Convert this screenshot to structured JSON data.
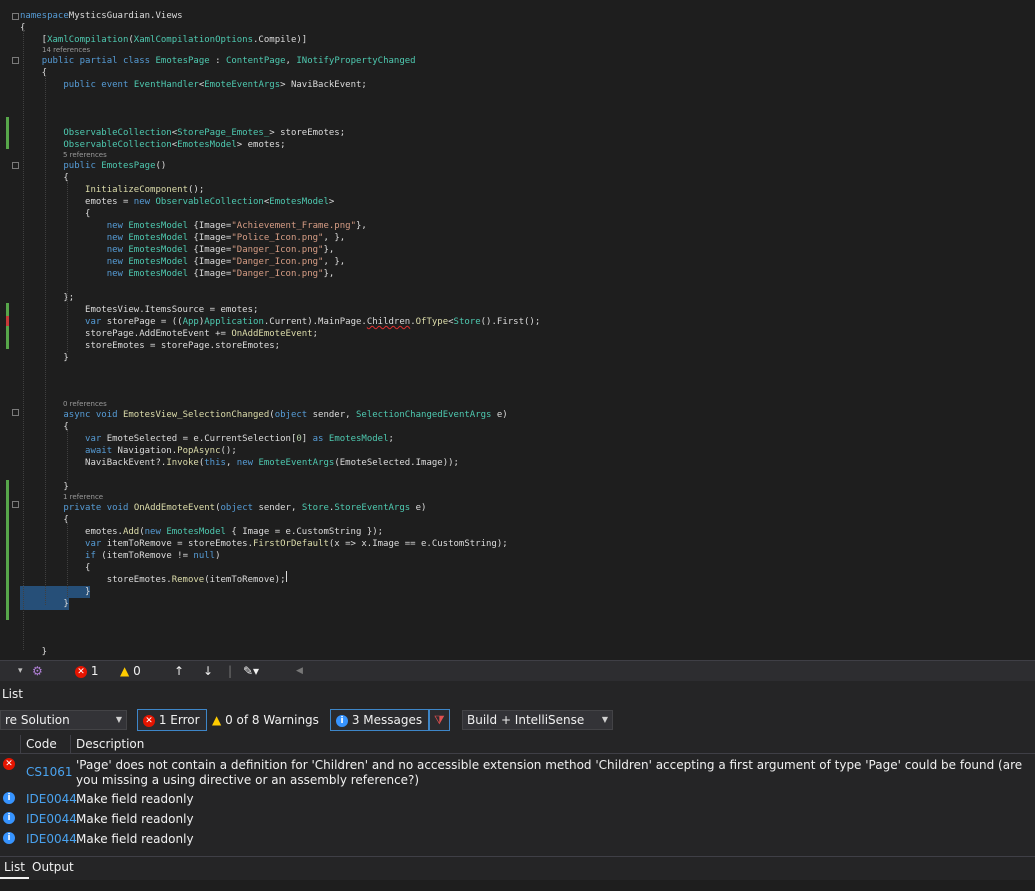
{
  "editor": {
    "lines": [
      {
        "t": "line",
        "parts": [
          [
            "kw",
            "namespace"
          ],
          [
            "",
            "MysticsGuardian.Views"
          ]
        ]
      },
      {
        "t": "line",
        "parts": [
          [
            "",
            "{"
          ]
        ]
      },
      {
        "t": "line",
        "parts": [
          [
            "",
            "    ["
          ],
          [
            "ty",
            "XamlCompilation"
          ],
          [
            "",
            "("
          ],
          [
            "ty",
            "XamlCompilationOptions"
          ],
          [
            "",
            ".Compile)]"
          ]
        ]
      },
      {
        "t": "ref",
        "text": "14 references"
      },
      {
        "t": "line",
        "parts": [
          [
            "",
            "    "
          ],
          [
            "kw",
            "public partial class"
          ],
          [
            "",
            ""
          ],
          [
            "ty",
            " EmotesPage"
          ],
          [
            "",
            " : "
          ],
          [
            "ty",
            "ContentPage"
          ],
          [
            "",
            ", "
          ],
          [
            "ty",
            "INotifyPropertyChanged"
          ]
        ]
      },
      {
        "t": "line",
        "parts": [
          [
            "",
            "    {"
          ]
        ]
      },
      {
        "t": "line",
        "parts": [
          [
            "",
            "        "
          ],
          [
            "kw",
            "public event"
          ],
          [
            "",
            " "
          ],
          [
            "ty",
            "EventHandler"
          ],
          [
            "",
            "<"
          ],
          [
            "ty",
            "EmoteEventArgs"
          ],
          [
            "",
            "> NaviBackEvent;"
          ]
        ]
      },
      {
        "t": "line",
        "parts": [
          [
            "",
            ""
          ]
        ]
      },
      {
        "t": "line",
        "parts": [
          [
            "",
            ""
          ]
        ]
      },
      {
        "t": "line",
        "parts": [
          [
            "",
            ""
          ]
        ]
      },
      {
        "t": "line",
        "parts": [
          [
            "",
            "        "
          ],
          [
            "ty",
            "ObservableCollection"
          ],
          [
            "",
            "<"
          ],
          [
            "ty",
            "StorePage_Emotes_"
          ],
          [
            "",
            "> storeEmotes;"
          ]
        ]
      },
      {
        "t": "line",
        "parts": [
          [
            "",
            "        "
          ],
          [
            "ty",
            "ObservableCollection"
          ],
          [
            "",
            "<"
          ],
          [
            "ty",
            "EmotesModel"
          ],
          [
            "",
            "> emotes;"
          ]
        ]
      },
      {
        "t": "ref",
        "text": "5 references"
      },
      {
        "t": "line",
        "parts": [
          [
            "",
            "        "
          ],
          [
            "kw",
            "public"
          ],
          [
            "",
            " "
          ],
          [
            "ty",
            "EmotesPage"
          ],
          [
            "",
            "()"
          ]
        ]
      },
      {
        "t": "line",
        "parts": [
          [
            "",
            "        {"
          ]
        ]
      },
      {
        "t": "line",
        "parts": [
          [
            "",
            "            "
          ],
          [
            "mt",
            "InitializeComponent"
          ],
          [
            "",
            "();"
          ]
        ]
      },
      {
        "t": "line",
        "parts": [
          [
            "",
            "            emotes = "
          ],
          [
            "kw",
            "new"
          ],
          [
            "",
            " "
          ],
          [
            "ty",
            "ObservableCollection"
          ],
          [
            "",
            "<"
          ],
          [
            "ty",
            "EmotesModel"
          ],
          [
            "",
            ">"
          ]
        ]
      },
      {
        "t": "line",
        "parts": [
          [
            "",
            "            {"
          ]
        ]
      },
      {
        "t": "line",
        "parts": [
          [
            "",
            "                "
          ],
          [
            "kw",
            "new"
          ],
          [
            "",
            " "
          ],
          [
            "ty",
            "EmotesModel"
          ],
          [
            "",
            " {Image="
          ],
          [
            "st",
            "\"Achievement_Frame.png\""
          ],
          [
            "",
            "},"
          ]
        ]
      },
      {
        "t": "line",
        "parts": [
          [
            "",
            "                "
          ],
          [
            "kw",
            "new"
          ],
          [
            "",
            " "
          ],
          [
            "ty",
            "EmotesModel"
          ],
          [
            "",
            " {Image="
          ],
          [
            "st",
            "\"Police_Icon.png\""
          ],
          [
            "",
            ", },"
          ]
        ]
      },
      {
        "t": "line",
        "parts": [
          [
            "",
            "                "
          ],
          [
            "kw",
            "new"
          ],
          [
            "",
            " "
          ],
          [
            "ty",
            "EmotesModel"
          ],
          [
            "",
            " {Image="
          ],
          [
            "st",
            "\"Danger_Icon.png\""
          ],
          [
            "",
            "},"
          ]
        ]
      },
      {
        "t": "line",
        "parts": [
          [
            "",
            "                "
          ],
          [
            "kw",
            "new"
          ],
          [
            "",
            " "
          ],
          [
            "ty",
            "EmotesModel"
          ],
          [
            "",
            " {Image="
          ],
          [
            "st",
            "\"Danger_Icon.png\""
          ],
          [
            "",
            ", },"
          ]
        ]
      },
      {
        "t": "line",
        "parts": [
          [
            "",
            "                "
          ],
          [
            "kw",
            "new"
          ],
          [
            "",
            " "
          ],
          [
            "ty",
            "EmotesModel"
          ],
          [
            "",
            " {Image="
          ],
          [
            "st",
            "\"Danger_Icon.png\""
          ],
          [
            "",
            "},"
          ]
        ]
      },
      {
        "t": "line",
        "parts": [
          [
            "",
            ""
          ]
        ]
      },
      {
        "t": "line",
        "parts": [
          [
            "",
            "        };"
          ]
        ]
      },
      {
        "t": "line",
        "parts": [
          [
            "",
            "            EmotesView.ItemsSource = emotes;"
          ]
        ]
      },
      {
        "t": "line",
        "parts": [
          [
            "",
            "            "
          ],
          [
            "kw",
            "var"
          ],
          [
            "",
            " storePage = (("
          ],
          [
            "ty",
            "App"
          ],
          [
            "",
            ")"
          ],
          [
            "ty",
            "Application"
          ],
          [
            "",
            ".Current).MainPage."
          ],
          [
            "squig",
            "Children"
          ],
          [
            "",
            "."
          ],
          [
            "mt",
            "OfType"
          ],
          [
            "",
            "<"
          ],
          [
            "ty",
            "Store"
          ],
          [
            ">",
            "().First();"
          ]
        ]
      },
      {
        "t": "line",
        "parts": [
          [
            "",
            "            storePage.AddEmoteEvent += "
          ],
          [
            "mt",
            "OnAddEmoteEvent"
          ],
          [
            "",
            ";"
          ]
        ]
      },
      {
        "t": "line",
        "parts": [
          [
            "",
            "            storeEmotes = storePage.storeEmotes;"
          ]
        ]
      },
      {
        "t": "line",
        "parts": [
          [
            "",
            "        }"
          ]
        ]
      },
      {
        "t": "line",
        "parts": [
          [
            "",
            ""
          ]
        ]
      },
      {
        "t": "line",
        "parts": [
          [
            "",
            ""
          ]
        ]
      },
      {
        "t": "line",
        "parts": [
          [
            "",
            ""
          ]
        ]
      },
      {
        "t": "ref",
        "text": "0 references"
      },
      {
        "t": "line",
        "parts": [
          [
            "",
            "        "
          ],
          [
            "kw",
            "async void"
          ],
          [
            "",
            " "
          ],
          [
            "mt",
            "EmotesView_SelectionChanged"
          ],
          [
            "",
            "("
          ],
          [
            "kw",
            "object"
          ],
          [
            "",
            " sender, "
          ],
          [
            "ty",
            "SelectionChangedEventArgs"
          ],
          [
            "",
            " e)"
          ]
        ]
      },
      {
        "t": "line",
        "parts": [
          [
            "",
            "        {"
          ]
        ]
      },
      {
        "t": "line",
        "parts": [
          [
            "",
            "            "
          ],
          [
            "kw",
            "var"
          ],
          [
            "",
            " EmoteSelected = e.CurrentSelection["
          ],
          [
            "nu",
            "0"
          ],
          [
            "",
            "] "
          ],
          [
            "kw",
            "as"
          ],
          [
            "",
            " "
          ],
          [
            "ty",
            "EmotesModel"
          ],
          [
            "",
            ";"
          ]
        ]
      },
      {
        "t": "line",
        "parts": [
          [
            "",
            "            "
          ],
          [
            "kw",
            "await"
          ],
          [
            "",
            " Navigation."
          ],
          [
            "mt",
            "PopAsync"
          ],
          [
            "",
            "();"
          ]
        ]
      },
      {
        "t": "line",
        "parts": [
          [
            "",
            "            NaviBackEvent?."
          ],
          [
            "mt",
            "Invoke"
          ],
          [
            "",
            "("
          ],
          [
            "kw",
            "this"
          ],
          [
            "",
            ", "
          ],
          [
            "kw",
            "new"
          ],
          [
            "",
            " "
          ],
          [
            "ty",
            "EmoteEventArgs"
          ],
          [
            "",
            "(EmoteSelected.Image));"
          ]
        ]
      },
      {
        "t": "line",
        "parts": [
          [
            "",
            ""
          ]
        ]
      },
      {
        "t": "line",
        "parts": [
          [
            "",
            "        }"
          ]
        ]
      },
      {
        "t": "ref",
        "text": "1 reference"
      },
      {
        "t": "line",
        "parts": [
          [
            "",
            "        "
          ],
          [
            "kw",
            "private void"
          ],
          [
            "",
            " "
          ],
          [
            "mt",
            "OnAddEmoteEvent"
          ],
          [
            "",
            "("
          ],
          [
            "kw",
            "object"
          ],
          [
            "",
            " sender, "
          ],
          [
            "ty",
            "Store"
          ],
          [
            "",
            "."
          ],
          [
            "ty",
            "StoreEventArgs"
          ],
          [
            "",
            " e)"
          ]
        ]
      },
      {
        "t": "line",
        "parts": [
          [
            "",
            "        {"
          ]
        ]
      },
      {
        "t": "line",
        "parts": [
          [
            "",
            "            emotes."
          ],
          [
            "mt",
            "Add"
          ],
          [
            "",
            "("
          ],
          [
            "kw",
            "new"
          ],
          [
            "",
            " "
          ],
          [
            "ty",
            "EmotesModel"
          ],
          [
            "",
            " { Image = e.CustomString });"
          ]
        ]
      },
      {
        "t": "line",
        "parts": [
          [
            "",
            "            "
          ],
          [
            "kw",
            "var"
          ],
          [
            "",
            " itemToRemove = storeEmotes."
          ],
          [
            "mt",
            "FirstOrDefault"
          ],
          [
            "",
            "(x => x.Image == e.CustomString);"
          ]
        ]
      },
      {
        "t": "line",
        "parts": [
          [
            "",
            "            "
          ],
          [
            "kw",
            "if"
          ],
          [
            "",
            " (itemToRemove != "
          ],
          [
            "kw",
            "null"
          ],
          [
            "",
            ")"
          ]
        ]
      },
      {
        "t": "line",
        "parts": [
          [
            "",
            "            {"
          ]
        ]
      },
      {
        "t": "line",
        "parts": [
          [
            "",
            "                storeEmotes."
          ],
          [
            "mt",
            "Remove"
          ],
          [
            "",
            "(itemToRemove);"
          ]
        ]
      },
      {
        "t": "line",
        "sel": true,
        "parts": [
          [
            "",
            "            }"
          ]
        ]
      },
      {
        "t": "line",
        "sel": true,
        "parts": [
          [
            "",
            "        }"
          ]
        ]
      },
      {
        "t": "line",
        "parts": [
          [
            "",
            ""
          ]
        ]
      },
      {
        "t": "line",
        "parts": [
          [
            "",
            ""
          ]
        ]
      },
      {
        "t": "line",
        "parts": [
          [
            "",
            ""
          ]
        ]
      },
      {
        "t": "line",
        "parts": [
          [
            "",
            "    }"
          ]
        ]
      }
    ]
  },
  "statusbar": {
    "error_count": "1",
    "warning_count": "0"
  },
  "panel": {
    "title": "List",
    "scope": "re Solution",
    "errors_label": "1 Error",
    "warnings_label": "0 of 8 Warnings",
    "messages_label": "3 Messages",
    "build_filter": "Build + IntelliSense",
    "columns": {
      "code": "Code",
      "description": "Description"
    },
    "rows": [
      {
        "severity": "error",
        "code": "CS1061",
        "description": "'Page' does not contain a definition for 'Children' and no accessible extension method 'Children' accepting a first argument of type 'Page' could be found (are you missing a using directive or an assembly reference?)"
      },
      {
        "severity": "info",
        "code": "IDE0044",
        "description": "Make field readonly"
      },
      {
        "severity": "info",
        "code": "IDE0044",
        "description": "Make field readonly"
      },
      {
        "severity": "info",
        "code": "IDE0044",
        "description": "Make field readonly"
      }
    ],
    "tabs": [
      "List",
      "Output"
    ]
  }
}
